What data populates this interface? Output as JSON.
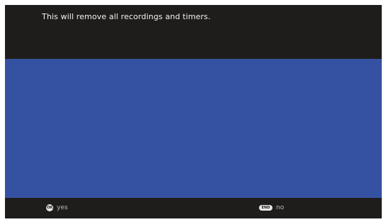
{
  "dialog": {
    "message": "This will remove all recordings and timers."
  },
  "actions": {
    "yes": {
      "key": "OK",
      "label": "yes"
    },
    "no": {
      "key": "END",
      "label": "no"
    }
  },
  "colors": {
    "background": "#1f1d1c",
    "content": "#3551a2",
    "text": "#f2f2f2"
  }
}
